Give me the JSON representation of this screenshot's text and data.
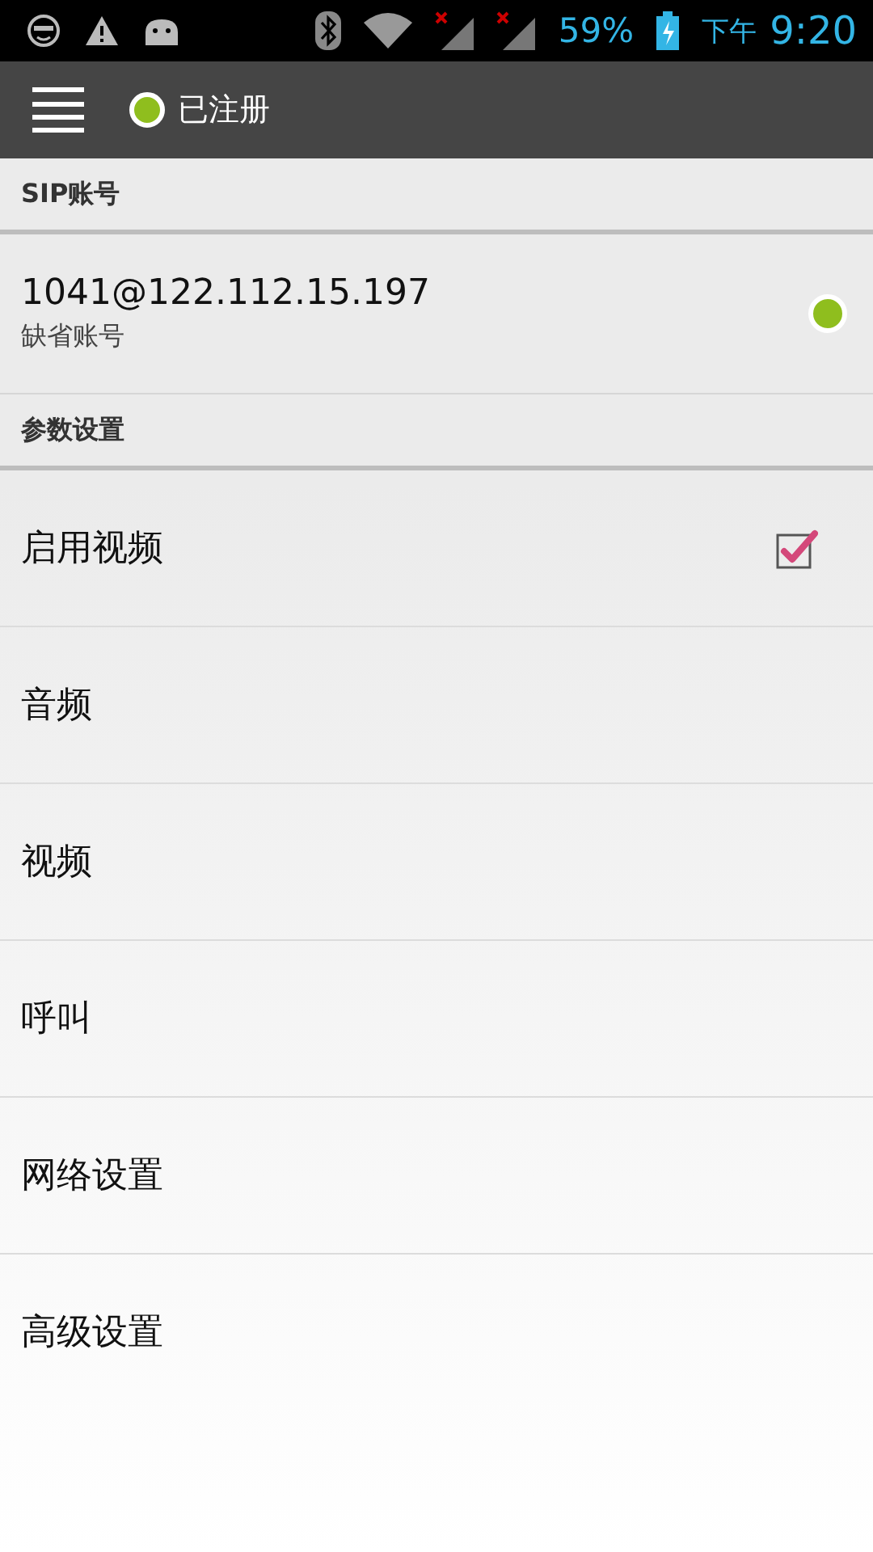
{
  "status_bar": {
    "battery": "59%",
    "time_period": "下午",
    "time": "9:20"
  },
  "action_bar": {
    "status": "已注册",
    "registered": true
  },
  "account_section": {
    "header": "SIP账号",
    "account": {
      "address": "1041@122.112.15.197",
      "label": "缺省账号",
      "online": true
    }
  },
  "settings_section": {
    "header": "参数设置",
    "items": [
      {
        "label": "启用视频",
        "kind": "checkbox",
        "checked": true
      },
      {
        "label": "音频",
        "kind": "plain"
      },
      {
        "label": "视频",
        "kind": "plain"
      },
      {
        "label": "呼叫",
        "kind": "plain"
      },
      {
        "label": "网络设置",
        "kind": "plain"
      },
      {
        "label": "高级设置",
        "kind": "plain"
      }
    ]
  }
}
